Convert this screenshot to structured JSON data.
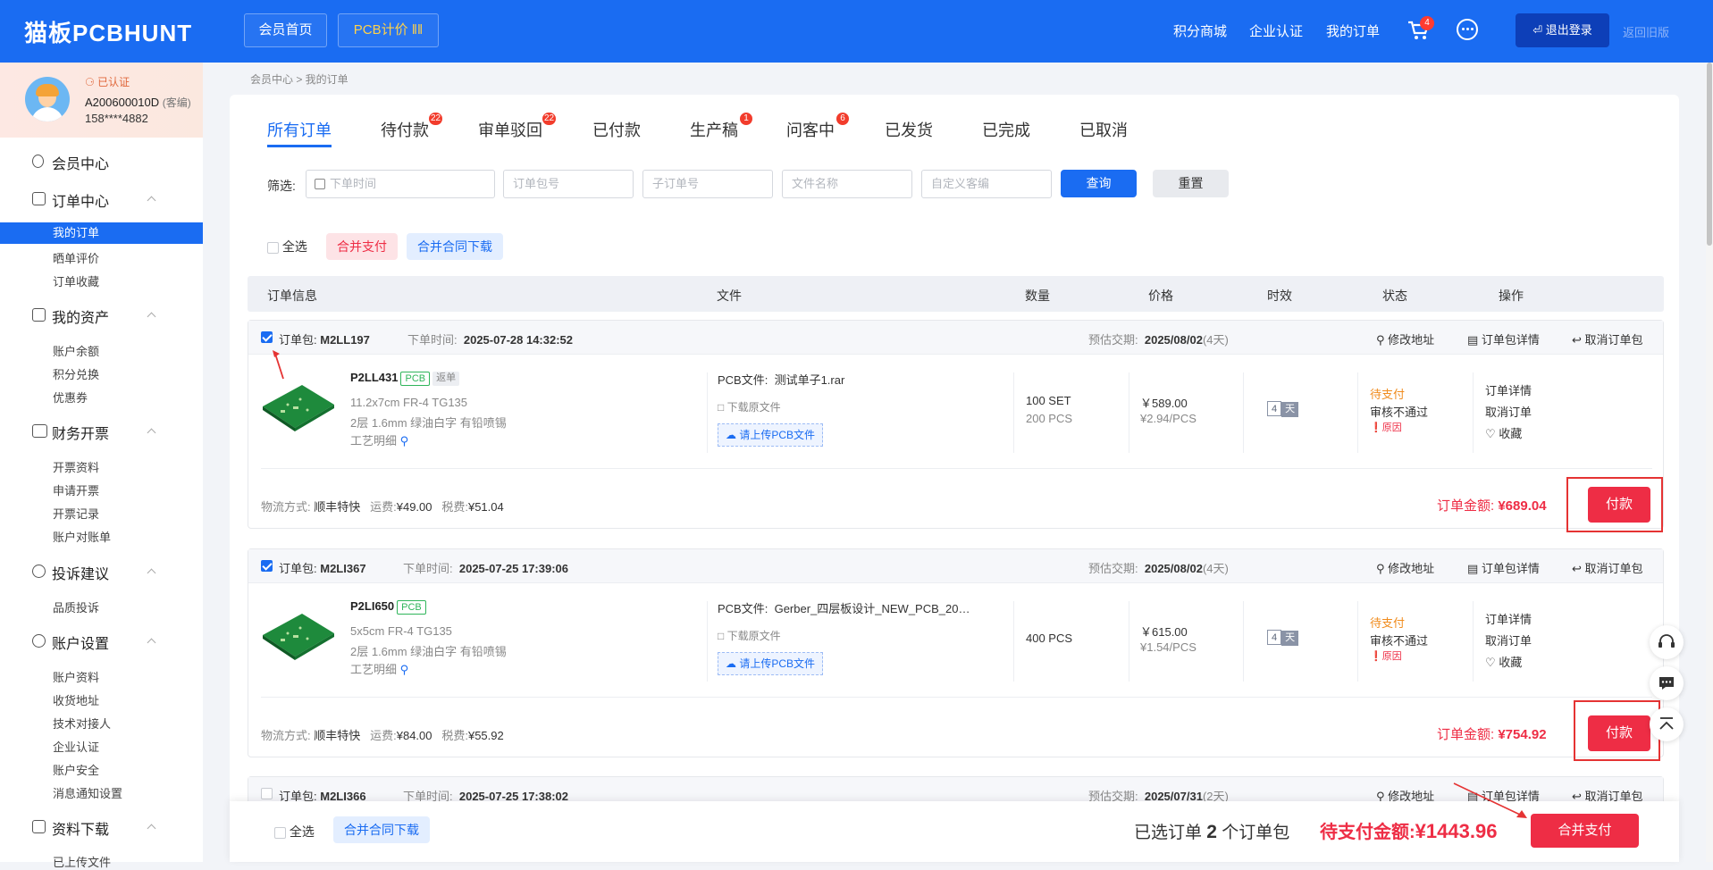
{
  "header": {
    "logo": "猫板PCBHUNT",
    "nav": [
      "会员首页",
      "PCB计价"
    ],
    "links": [
      "积分商城",
      "企业认证",
      "我的订单"
    ],
    "cart_count": "4",
    "logout": "退出登录",
    "old_version": "返回旧版"
  },
  "user": {
    "verified": "已认证",
    "id": "A200600010D",
    "role": "(客编)",
    "phone": "158****4882"
  },
  "sidebar": {
    "member_center": "会员中心",
    "order_center": "订单中心",
    "order_items": [
      "我的订单",
      "晒单评价",
      "订单收藏"
    ],
    "assets": "我的资产",
    "assets_items": [
      "账户余额",
      "积分兑换",
      "优惠券"
    ],
    "finance": "财务开票",
    "finance_items": [
      "开票资料",
      "申请开票",
      "开票记录",
      "账户对账单"
    ],
    "complaint": "投诉建议",
    "complaint_items": [
      "品质投诉"
    ],
    "settings": "账户设置",
    "settings_items": [
      "账户资料",
      "收货地址",
      "技术对接人",
      "企业认证",
      "账户安全",
      "消息通知设置"
    ],
    "download": "资料下载",
    "download_items": [
      "已上传文件"
    ]
  },
  "breadcrumb": "会员中心 > 我的订单",
  "tabs": [
    {
      "label": "所有订单",
      "badge": ""
    },
    {
      "label": "待付款",
      "badge": "22"
    },
    {
      "label": "审单驳回",
      "badge": "22"
    },
    {
      "label": "已付款",
      "badge": ""
    },
    {
      "label": "生产稿",
      "badge": "1"
    },
    {
      "label": "问客中",
      "badge": "6"
    },
    {
      "label": "已发货",
      "badge": ""
    },
    {
      "label": "已完成",
      "badge": ""
    },
    {
      "label": "已取消",
      "badge": ""
    }
  ],
  "filter": {
    "label": "筛选:",
    "placeholders": [
      "下单时间",
      "订单包号",
      "子订单号",
      "文件名称",
      "自定义客编"
    ],
    "query": "查询",
    "reset": "重置"
  },
  "actions": {
    "select_all": "全选",
    "merge_pay": "合并支付",
    "merge_contract": "合并合同下载"
  },
  "table_headers": [
    "订单信息",
    "文件",
    "数量",
    "价格",
    "时效",
    "状态",
    "操作"
  ],
  "order_labels": {
    "package": "订单包:",
    "order_time": "下单时间:",
    "est_delivery": "预估交期:",
    "edit_address": "修改地址",
    "package_detail": "订单包详情",
    "cancel_package": "取消订单包",
    "pcb_file": "PCB文件:",
    "download_file": "下载原文件",
    "upload_pcb": "请上传PCB文件",
    "craft": "工艺明细",
    "shipping": "物流方式:",
    "freight": "运费:",
    "tax": "税费:",
    "amount_label": "订单金额:",
    "pay": "付款",
    "ops": [
      "订单详情",
      "取消订单",
      "收藏"
    ],
    "reason": "原因",
    "day": "天"
  },
  "orders": [
    {
      "package_id": "M2LL197",
      "order_time": "2025-07-28 14:32:52",
      "delivery_date": "2025/08/02",
      "delivery_days": "(4天)",
      "item_id": "P2LL431",
      "tags": [
        "PCB",
        "返单"
      ],
      "spec1": "11.2x7cm FR-4 TG135",
      "spec2": "2层 1.6mm 绿油白字 有铅喷锡",
      "file": "测试单子1.rar",
      "qty": "100 SET",
      "qty_pcs": "200 PCS",
      "price": "￥589.00",
      "unit_price": "¥2.94/PCS",
      "lead_days": "4",
      "status": "待支付",
      "review": "审核不通过",
      "shipping": "顺丰特快",
      "freight": "¥49.00",
      "tax": "¥51.04",
      "amount": "¥689.04"
    },
    {
      "package_id": "M2LI367",
      "order_time": "2025-07-25 17:39:06",
      "delivery_date": "2025/08/02",
      "delivery_days": "(4天)",
      "item_id": "P2LI650",
      "tags": [
        "PCB"
      ],
      "spec1": "5x5cm FR-4 TG135",
      "spec2": "2层 1.6mm 绿油白字 有铅喷锡",
      "file": "Gerber_四层板设计_NEW_PCB_20…",
      "qty": "400 PCS",
      "qty_pcs": "",
      "price": "￥615.00",
      "unit_price": "¥1.54/PCS",
      "lead_days": "4",
      "status": "待支付",
      "review": "审核不通过",
      "shipping": "顺丰特快",
      "freight": "¥84.00",
      "tax": "¥55.92",
      "amount": "¥754.92"
    },
    {
      "package_id": "M2LI366",
      "order_time": "2025-07-25 17:38:02",
      "delivery_date": "2025/07/31",
      "delivery_days": "(2天)"
    }
  ],
  "bottom": {
    "select_all": "全选",
    "merge_contract": "合并合同下载",
    "selected_prefix": "已选订单",
    "selected_count": "2",
    "selected_suffix": "个订单包",
    "pending_label": "待支付金额:",
    "pending_amount": "¥1443.96",
    "merge_pay": "合并支付"
  },
  "colors": {
    "brand": "#1a6cf2",
    "danger": "#ee2d45",
    "pending": "#f08c1e"
  }
}
